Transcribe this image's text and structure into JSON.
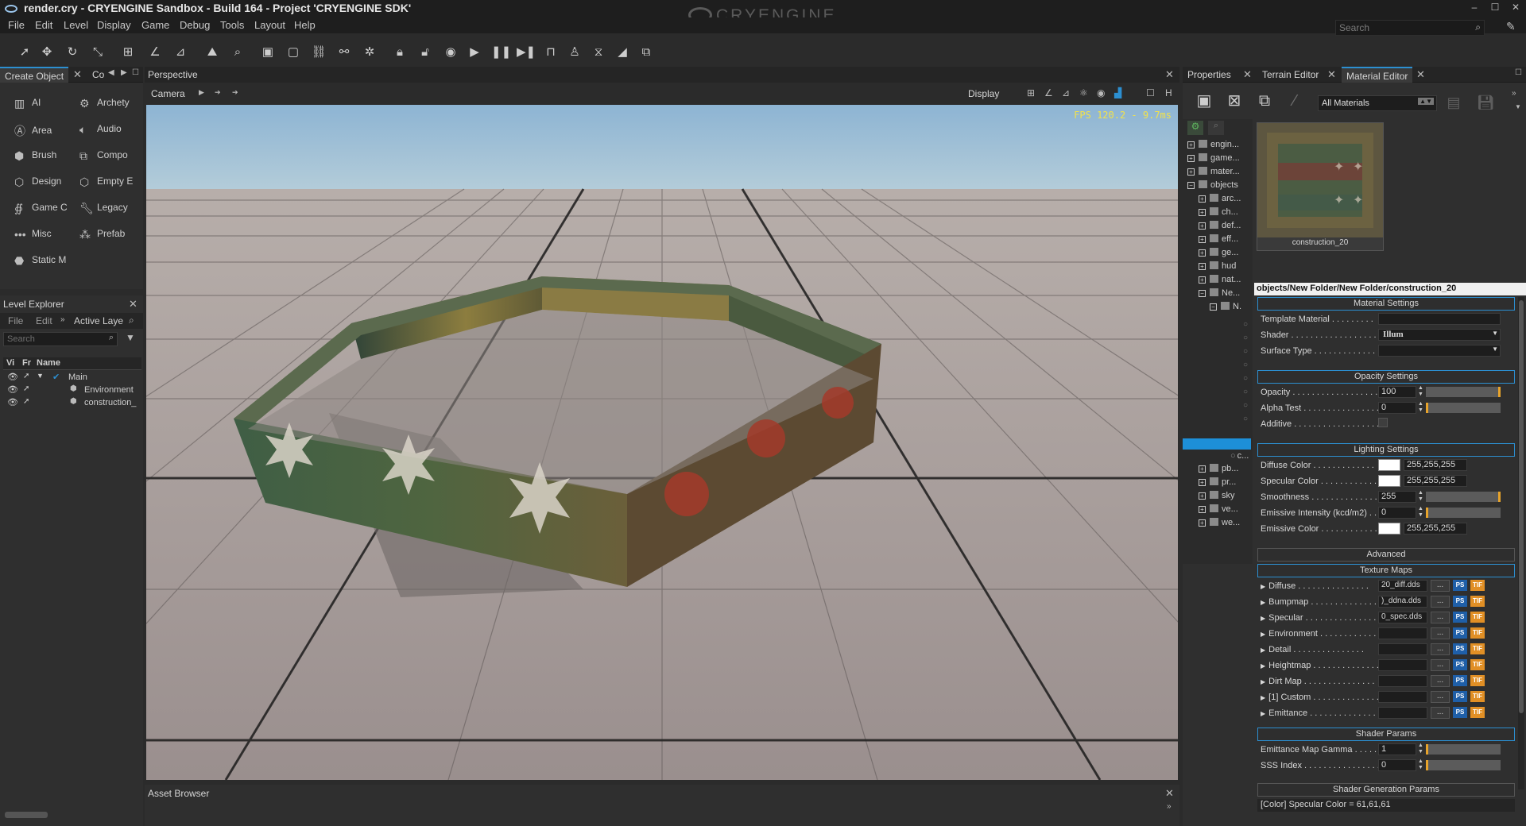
{
  "window": {
    "title": "render.cry - CRYENGINE Sandbox - Build 164 - Project 'CRYENGINE SDK'",
    "logo_text": "CRYENGINE",
    "search_placeholder": "Search"
  },
  "menu": [
    "File",
    "Edit",
    "Level",
    "Display",
    "Game",
    "Debug",
    "Tools",
    "Layout",
    "Help"
  ],
  "create_object": {
    "tab_label": "Create Object",
    "tab2_label": "Co",
    "items_left": [
      "AI",
      "Area",
      "Brush",
      "Design",
      "Game C",
      "Misc",
      "Static M"
    ],
    "items_right": [
      "Archety",
      "Audio",
      "Compo",
      "Empty E",
      "Legacy",
      "Prefab"
    ]
  },
  "level_explorer": {
    "title": "Level Explorer",
    "menu": [
      "File",
      "Edit",
      "Active Laye"
    ],
    "search_placeholder": "Search",
    "columns": [
      "Vi",
      "Fr",
      "Name"
    ],
    "rows": [
      "Main",
      "Environment",
      "construction_"
    ]
  },
  "viewport": {
    "title": "Perspective",
    "camera_label": "Camera",
    "display_label": "Display",
    "fps_text": "FPS 120.2 - 9.7ms",
    "colors": {
      "sky_top": "#8db4d3",
      "sky_bottom": "#b3ccd9",
      "floor": "#a89d9b"
    }
  },
  "asset_browser": {
    "title": "Asset Browser"
  },
  "right_tabs": [
    "Properties",
    "Terrain Editor",
    "Material Editor"
  ],
  "material_editor": {
    "filter_value": "All Materials",
    "tree": [
      {
        "label": "engin...",
        "level": 0,
        "sign": "+"
      },
      {
        "label": "game...",
        "level": 0,
        "sign": "+"
      },
      {
        "label": "mater...",
        "level": 0,
        "sign": "+"
      },
      {
        "label": "objects",
        "level": 0,
        "sign": "−"
      },
      {
        "label": "arc...",
        "level": 1,
        "sign": "+"
      },
      {
        "label": "ch...",
        "level": 1,
        "sign": "+"
      },
      {
        "label": "def...",
        "level": 1,
        "sign": "+"
      },
      {
        "label": "eff...",
        "level": 1,
        "sign": "+"
      },
      {
        "label": "ge...",
        "level": 1,
        "sign": "+"
      },
      {
        "label": "hud",
        "level": 1,
        "sign": "+"
      },
      {
        "label": "nat...",
        "level": 1,
        "sign": "+"
      },
      {
        "label": "Ne...",
        "level": 1,
        "sign": "−"
      },
      {
        "label": "N.",
        "level": 2,
        "sign": "−"
      },
      {
        "label": "c...",
        "level": 3,
        "sign": ""
      },
      {
        "label": "pb...",
        "level": 1,
        "sign": "+"
      },
      {
        "label": "pr...",
        "level": 1,
        "sign": "+"
      },
      {
        "label": "sky",
        "level": 1,
        "sign": "+"
      },
      {
        "label": "ve...",
        "level": 1,
        "sign": "+"
      },
      {
        "label": "we...",
        "level": 1,
        "sign": "+"
      }
    ],
    "preview_caption": "construction_20",
    "path": "objects/New Folder/New Folder/construction_20",
    "material_settings": {
      "header": "Material Settings",
      "template_label": "Template Material",
      "shader_label": "Shader",
      "shader_value": "Illum",
      "surface_label": "Surface Type"
    },
    "opacity_settings": {
      "header": "Opacity Settings",
      "opacity_label": "Opacity",
      "opacity_value": "100",
      "alpha_label": "Alpha Test",
      "alpha_value": "0",
      "additive_label": "Additive"
    },
    "lighting_settings": {
      "header": "Lighting Settings",
      "diffuse_label": "Diffuse Color",
      "diffuse_value": "255,255,255",
      "specular_label": "Specular Color",
      "specular_value": "255,255,255",
      "smooth_label": "Smoothness",
      "smooth_value": "255",
      "emint_label": "Emissive Intensity (kcd/m2)",
      "emint_value": "0",
      "emcol_label": "Emissive Color",
      "emcol_value": "255,255,255"
    },
    "advanced_header": "Advanced",
    "texture_header": "Texture Maps",
    "textures": [
      {
        "label": "Diffuse",
        "value": "20_diff.dds"
      },
      {
        "label": "Bumpmap",
        "value": ")_ddna.dds"
      },
      {
        "label": "Specular",
        "value": "0_spec.dds"
      },
      {
        "label": "Environment",
        "value": ""
      },
      {
        "label": "Detail",
        "value": ""
      },
      {
        "label": "Heightmap",
        "value": ""
      },
      {
        "label": "Dirt Map",
        "value": ""
      },
      {
        "label": "[1] Custom",
        "value": ""
      },
      {
        "label": "Emittance",
        "value": ""
      }
    ],
    "shader_params": {
      "header": "Shader Params",
      "gamma_label": "Emittance Map Gamma",
      "gamma_value": "1",
      "sss_label": "SSS Index",
      "sss_value": "0"
    },
    "shader_gen_header": "Shader Generation Params",
    "status_text": "[Color] Specular Color = 61,61,61"
  }
}
